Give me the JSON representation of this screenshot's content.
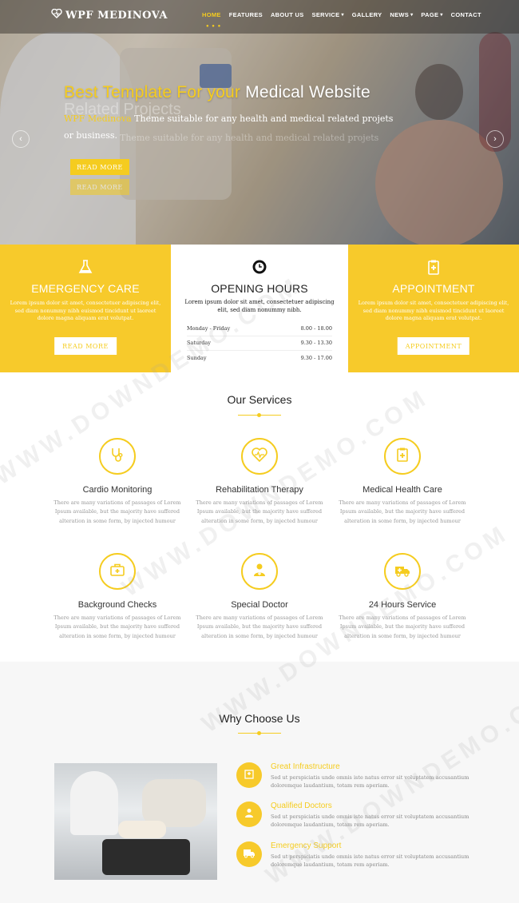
{
  "brand": {
    "logo_text": "WPF MEDINOVA"
  },
  "nav": {
    "items": [
      "HOME",
      "FEATURES",
      "ABOUT US",
      "SERVICE",
      "GALLERY",
      "NEWS",
      "PAGE",
      "CONTACT"
    ],
    "active": "HOME",
    "dropdown_items": [
      "SERVICE",
      "NEWS",
      "PAGE"
    ]
  },
  "hero": {
    "title_prefix": "Best Template For your",
    "title_suffix": "Medical Website",
    "ghost_line": "Related Projects",
    "subtitle_highlight": "WPF Medinova",
    "subtitle_rest": "Theme suitable for any health and medical related projets",
    "subtitle_line2": "or business.",
    "ghost_line2": "Theme suitable for any health and medical related projets",
    "button_label": "READ MORE",
    "button_label_2": "READ MORE"
  },
  "info_boxes": {
    "emergency": {
      "title": "EMERGENCY CARE",
      "text": "Lorem ipsum dolor sit amet, consectetuer adipiscing elit, sed diam nonummy nibh euismod tincidunt ut laoreet dolore magna aliquam erat volutpat.",
      "button_label": "READ MORE"
    },
    "hours": {
      "title": "OPENING HOURS",
      "text": "Lorem ipsum dolor sit amet, consectetuer adipiscing elit, sed diam nonummy nibh.",
      "rows": [
        {
          "day": "Monday - Friday",
          "time": "8.00 - 18.00"
        },
        {
          "day": "Saturday",
          "time": "9.30 - 13.30"
        },
        {
          "day": "Sunday",
          "time": "9.30 - 17.00"
        }
      ]
    },
    "appointment": {
      "title": "APPOINTMENT",
      "text": "Lorem ipsum dolor sit amet, consectetuer adipiscing elit, sed diam nonummy nibh euismod tincidunt ut laoreet dolore magna aliquam erat volutpat.",
      "button_label": "APPOINTMENT"
    }
  },
  "services": {
    "title": "Our Services",
    "items": [
      {
        "title": "Cardio Monitoring",
        "icon": "stethoscope-icon",
        "text": "There are many variations of passages of Lorem Ipsum available, but the majority have suffered alteration in some form, by injected humour"
      },
      {
        "title": "Rehabilitation Therapy",
        "icon": "heartbeat-icon",
        "text": "There are many variations of passages of Lorem Ipsum available, but the majority have suffered alteration in some form, by injected humour"
      },
      {
        "title": "Medical Health Care",
        "icon": "medical-kit-icon",
        "text": "There are many variations of passages of Lorem Ipsum available, but the majority have suffered alteration in some form, by injected humour"
      },
      {
        "title": "Background Checks",
        "icon": "briefcase-medical-icon",
        "text": "There are many variations of passages of Lorem Ipsum available, but the majority have suffered alteration in some form, by injected humour"
      },
      {
        "title": "Special Doctor",
        "icon": "doctor-icon",
        "text": "There are many variations of passages of Lorem Ipsum available, but the majority have suffered alteration in some form, by injected humour"
      },
      {
        "title": "24 Hours Service",
        "icon": "ambulance-icon",
        "text": "There are many variations of passages of Lorem Ipsum available, but the majority have suffered alteration in some form, by injected humour"
      }
    ]
  },
  "why": {
    "title": "Why Choose Us",
    "items": [
      {
        "title": "Great Infrastructure",
        "icon": "hospital-icon",
        "text": "Sed ut perspiciatis unde omnis iste natus error sit voluptatem accusantium doloremque laudantium, totam rem aperiam."
      },
      {
        "title": "Qualified Doctors",
        "icon": "doctor-icon",
        "text": "Sed ut perspiciatis unde omnis iste natus error sit voluptatem accusantium doloremque laudantium, totam rem aperiam."
      },
      {
        "title": "Emergency Support",
        "icon": "ambulance-icon",
        "text": "Sed ut perspiciatis unde omnis iste natus error sit voluptatem accusantium doloremque laudantium, totam rem aperiam."
      }
    ]
  },
  "watermark": "WWW.DOWNDEMO.COM",
  "colors": {
    "accent": "#f5cc1f",
    "accent_box": "#f7ca2b",
    "text_dark": "#222222",
    "text_muted": "#999999"
  }
}
